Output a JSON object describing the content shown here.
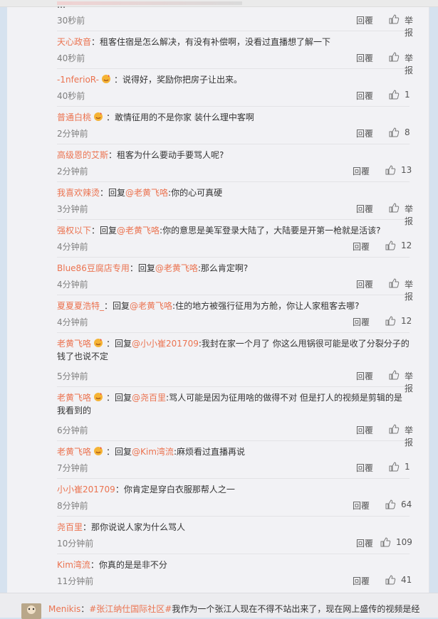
{
  "ui": {
    "reply_label": "回覆",
    "report_label": "举报"
  },
  "comments": [
    {
      "nick": "",
      "parts": [
        {
          "t": "…"
        }
      ],
      "time": "30秒前",
      "likes": null
    },
    {
      "nick": "天心政音",
      "parts": [
        {
          "t": "：租客住宿是怎么解决，有没有补偿啊，没看过直播想了解一下"
        }
      ],
      "time": "40秒前",
      "likes": null
    },
    {
      "nick": "-1nferioR-",
      "badge": true,
      "parts": [
        {
          "t": "：说得好，奖励你把房子让出来。"
        }
      ],
      "time": "40秒前",
      "likes": "1"
    },
    {
      "nick": "普通白桃",
      "badge": true,
      "parts": [
        {
          "t": "：敢情征用的不是你家 装什么理中客啊"
        }
      ],
      "time": "2分钟前",
      "likes": "8"
    },
    {
      "nick": "高级恩的艾斯",
      "parts": [
        {
          "t": "：租客为什么要动手要骂人呢?"
        }
      ],
      "time": "2分钟前",
      "likes": "13"
    },
    {
      "nick": "我喜欢辣烫",
      "parts": [
        {
          "t": "：回复"
        },
        {
          "m": "@老黄飞咯"
        },
        {
          "t": ":你的心可真硬"
        }
      ],
      "time": "3分钟前",
      "likes": null
    },
    {
      "nick": "强权以下",
      "parts": [
        {
          "t": "：回复"
        },
        {
          "m": "@老黄飞咯"
        },
        {
          "t": ":你的意思是美军登录大陆了，大陆要是开第一枪就是活该?"
        }
      ],
      "time": "4分钟前",
      "likes": "12"
    },
    {
      "nick": "Blue86豆腐店专用",
      "parts": [
        {
          "t": "：回复"
        },
        {
          "m": "@老黄飞咯"
        },
        {
          "t": ":那么肯定啊?"
        }
      ],
      "time": "4分钟前",
      "likes": null
    },
    {
      "nick": "夏夏夏浩特_",
      "parts": [
        {
          "t": "：回复"
        },
        {
          "m": "@老黄飞咯"
        },
        {
          "t": ":住的地方被强行征用为方舱，你让人家租客去哪?"
        }
      ],
      "time": "4分钟前",
      "likes": "12"
    },
    {
      "nick": "老黄飞咯",
      "badge": true,
      "parts": [
        {
          "t": "：回复"
        },
        {
          "m": "@小小崔201709"
        },
        {
          "t": ":我封在家一个月了 你这么甩锅很可能是收了分裂分子的钱了也说不定"
        }
      ],
      "time": "5分钟前",
      "likes": null
    },
    {
      "nick": "老黄飞咯",
      "badge": true,
      "parts": [
        {
          "t": "：回复"
        },
        {
          "m": "@尧百里"
        },
        {
          "t": ":骂人可能是因为征用啥的做得不对 但是打人的视频是剪辑的是我看到的"
        }
      ],
      "time": "6分钟前",
      "likes": null
    },
    {
      "nick": "老黄飞咯",
      "badge": true,
      "parts": [
        {
          "t": "：回复"
        },
        {
          "m": "@Kim湾流"
        },
        {
          "t": ":麻烦看过直播再说"
        }
      ],
      "time": "7分钟前",
      "likes": "1"
    },
    {
      "nick": "小小崔201709",
      "parts": [
        {
          "t": "：你肯定是穿白衣服那帮人之一"
        }
      ],
      "time": "8分钟前",
      "likes": "64"
    },
    {
      "nick": "尧百里",
      "parts": [
        {
          "t": "：那你说说人家为什么骂人"
        }
      ],
      "time": "10分钟前",
      "likes": "109"
    },
    {
      "nick": "Kim湾流",
      "parts": [
        {
          "t": "：你真的是是非不分"
        }
      ],
      "time": "11分钟前",
      "likes": "41"
    }
  ],
  "footer_post": {
    "user": "Menikis",
    "sep": "：",
    "tag": "#张江纳仕国际社区#",
    "text": "我作为一个张江人现在不得不站出来了，现在网上盛传的视频是经"
  }
}
